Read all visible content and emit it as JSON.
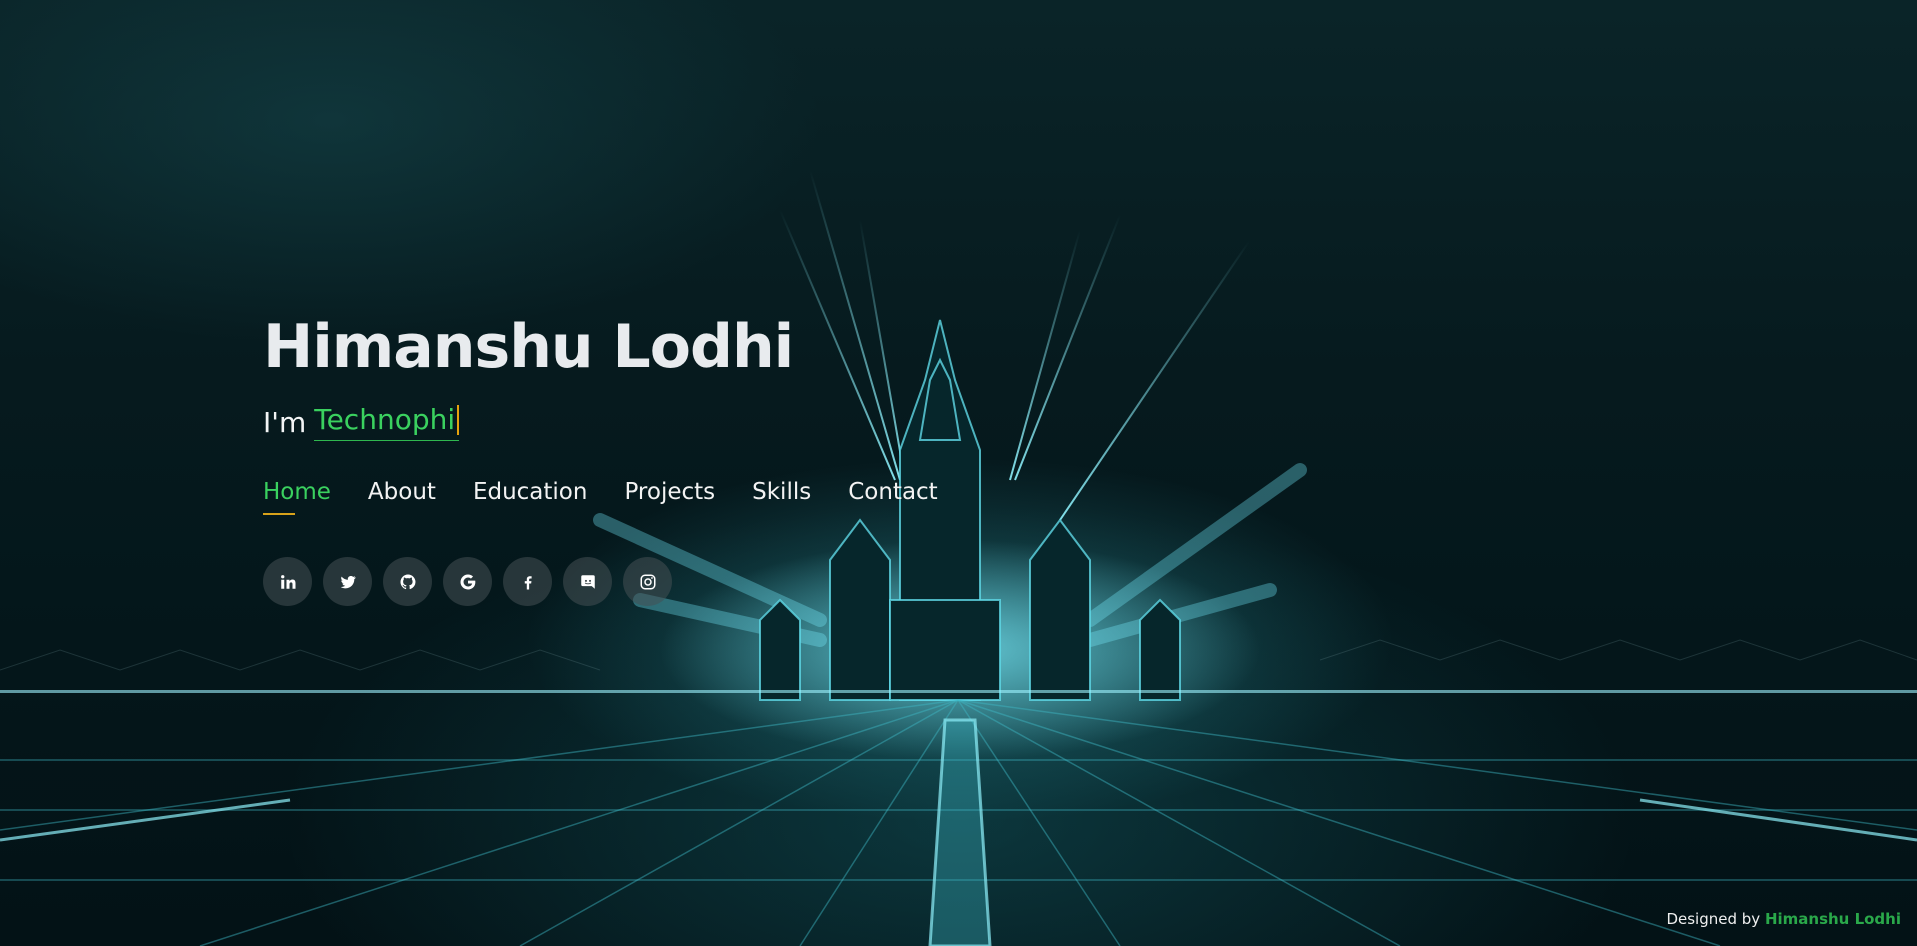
{
  "hero": {
    "name": "Himanshu Lodhi",
    "prefix": "I'm",
    "typed_text": "Technophi"
  },
  "nav": {
    "items": [
      {
        "label": "Home",
        "active": true
      },
      {
        "label": "About"
      },
      {
        "label": "Education"
      },
      {
        "label": "Projects"
      },
      {
        "label": "Skills"
      },
      {
        "label": "Contact"
      }
    ]
  },
  "socials": [
    {
      "icon": "linkedin-icon"
    },
    {
      "icon": "twitter-icon"
    },
    {
      "icon": "github-icon"
    },
    {
      "icon": "google-icon"
    },
    {
      "icon": "facebook-icon"
    },
    {
      "icon": "discord-icon"
    },
    {
      "icon": "instagram-icon"
    }
  ],
  "footer": {
    "designed_by": "Designed by",
    "author": "Himanshu Lodhi"
  },
  "colors": {
    "accent": "#3ad15f",
    "underline": "#d8a21a",
    "text": "#e8ebee"
  }
}
